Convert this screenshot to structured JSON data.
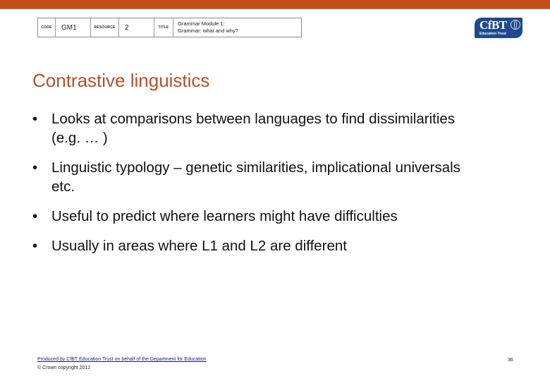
{
  "header": {
    "code_label": "CODE",
    "code_value": "GM1",
    "resource_label": "RESOURCE",
    "resource_value": "2",
    "title_label": "TITLE",
    "title_line1": "Grammar Module 1:",
    "title_line2": "Grammar: what and why?"
  },
  "logo": {
    "main": "CfBT",
    "sub": "Education Trust",
    "icon": "globe-hand-icon",
    "color": "#1e4a8c"
  },
  "slide": {
    "title": "Contrastive linguistics",
    "title_color": "#b4502a",
    "bullets": [
      "Looks at comparisons between languages to find dissimilarities (e.g. … )",
      "Linguistic typology – genetic similarities, implicational universals etc.",
      "Useful to predict where learners might have difficulties",
      "Usually in areas where L1 and L2 are different"
    ],
    "bullet_glyph": "•"
  },
  "footer": {
    "link": "Produced by CfBT Education Trust on behalf of the Department for Education",
    "copyright": "© Crown copyright 2012",
    "page_number": "36"
  },
  "colors": {
    "top_bar": "#c05018"
  }
}
